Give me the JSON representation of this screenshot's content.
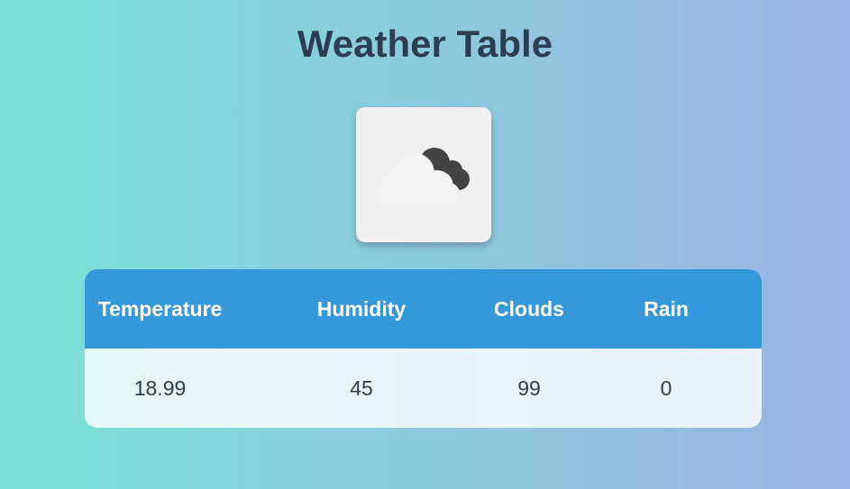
{
  "page": {
    "title": "Weather Table"
  },
  "weather_icon": {
    "name": "cloudy-icon"
  },
  "table": {
    "headers": [
      "Temperature",
      "Humidity",
      "Clouds",
      "Rain"
    ],
    "row": [
      "18.99",
      "45",
      "99",
      "0"
    ]
  },
  "colors": {
    "title": "#2c3e50",
    "header_bg": "#3498db",
    "header_text": "#ffffff",
    "cell_text": "#2c3e50"
  }
}
